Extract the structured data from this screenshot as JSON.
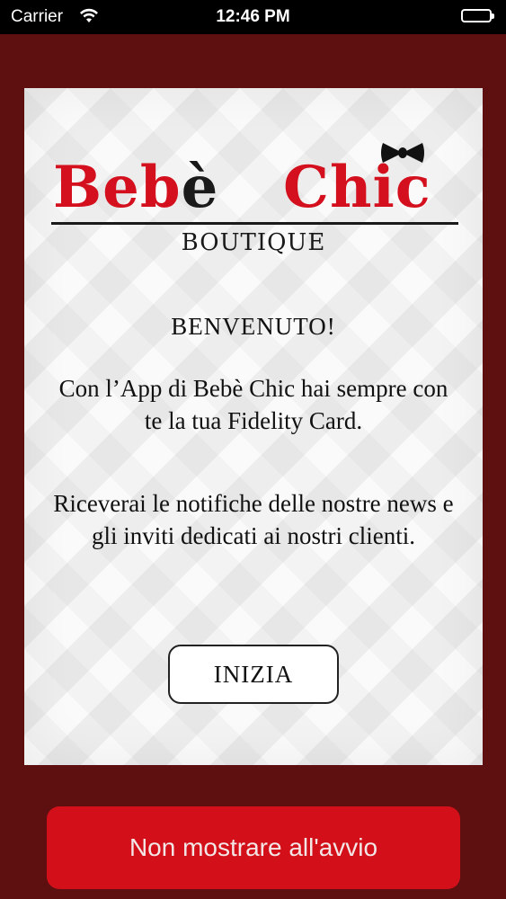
{
  "status_bar": {
    "carrier": "Carrier",
    "time": "12:46 PM",
    "wifi_icon": "wifi-icon",
    "battery_icon": "battery-icon"
  },
  "logo": {
    "word_first": "Beb",
    "word_first_accent": "è",
    "word_second": "Chic",
    "subtitle": "BOUTIQUE",
    "bow_icon": "bow-tie-icon",
    "brand_red": "#d4101e"
  },
  "welcome": {
    "title": "BENVENUTO!",
    "paragraph1": "Con l’App di Bebè Chic hai sempre con te la tua Fidelity Card.",
    "paragraph2": "Riceverai le notifiche delle nostre news e gli inviti dedicati ai nostri clienti.",
    "start_label": "INIZIA"
  },
  "footer": {
    "dismiss_label": "Non mostrare all'avvio"
  },
  "colors": {
    "background": "#5e1010",
    "button_red": "#d3101a"
  }
}
